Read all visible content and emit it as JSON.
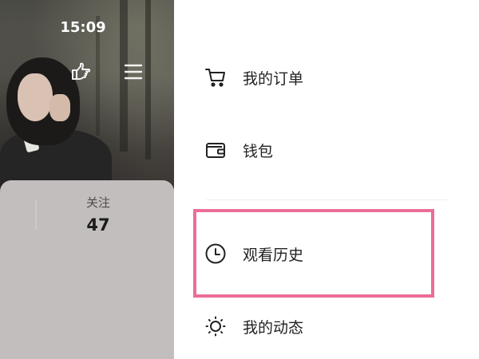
{
  "status_bar": {
    "time": "15:09"
  },
  "profile": {
    "header_icons": {
      "hand": "pointing-hand-icon",
      "menu": "hamburger-menu-icon"
    },
    "stats": {
      "follow_label": "关注",
      "follow_count": "47"
    }
  },
  "drawer": {
    "items": [
      {
        "label": "我的订单",
        "icon": "cart-icon"
      },
      {
        "label": "钱包",
        "icon": "wallet-icon"
      },
      {
        "label": "观看历史",
        "icon": "clock-icon"
      },
      {
        "label": "我的动态",
        "icon": "sun-icon"
      }
    ]
  },
  "colors": {
    "highlight": "#eb6d95",
    "text": "#222222",
    "card": "#c1bebd"
  }
}
